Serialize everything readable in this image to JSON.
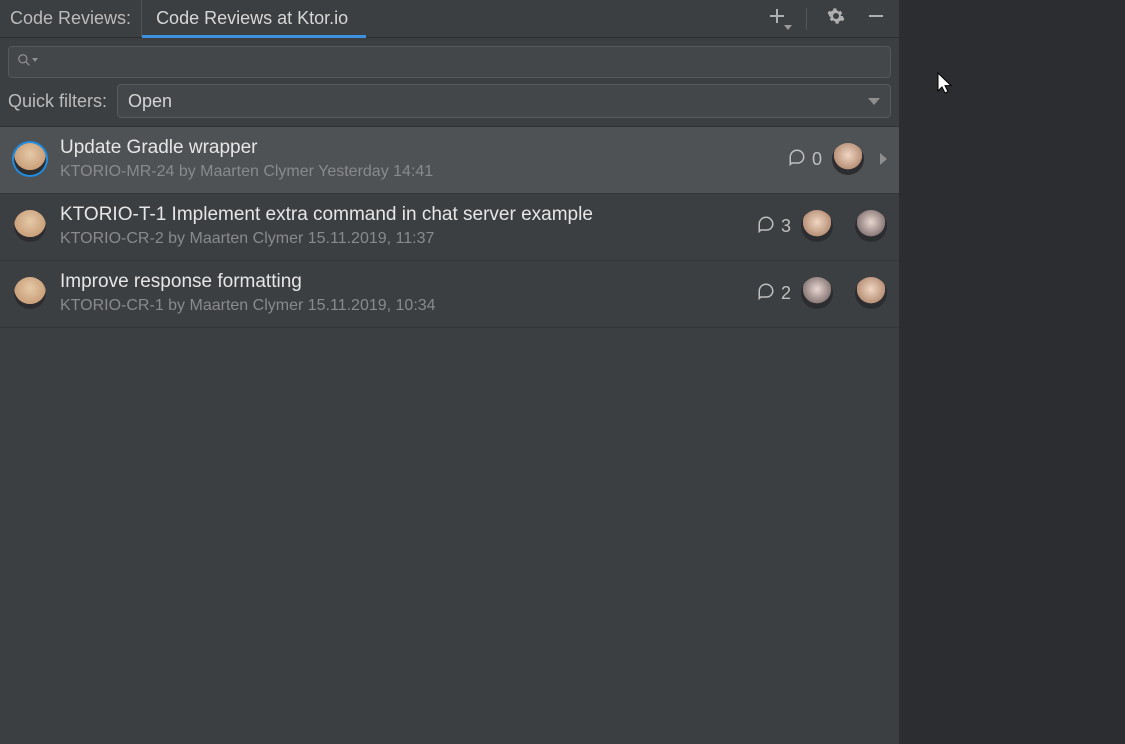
{
  "header": {
    "title": "Code Reviews:",
    "tab": "Code Reviews at Ktor.io",
    "icons": {
      "add": "plus-icon",
      "settings": "gear-icon",
      "hide": "minimize-icon"
    }
  },
  "search": {
    "value": ""
  },
  "filters": {
    "label": "Quick filters:",
    "selected": "Open"
  },
  "reviews": [
    {
      "title": "Update Gradle wrapper",
      "meta": "KTORIO-MR-24 by Maarten Clymer Yesterday 14:41",
      "comments": "0",
      "selected": true,
      "expand": true
    },
    {
      "title": "KTORIO-T-1 Implement extra command in chat server example",
      "meta": "KTORIO-CR-2 by Maarten Clymer 15.11.2019, 11:37",
      "comments": "3",
      "selected": false,
      "expand": false
    },
    {
      "title": "Improve response formatting",
      "meta": "KTORIO-CR-1 by Maarten Clymer 15.11.2019, 10:34",
      "comments": "2",
      "selected": false,
      "expand": false
    }
  ]
}
